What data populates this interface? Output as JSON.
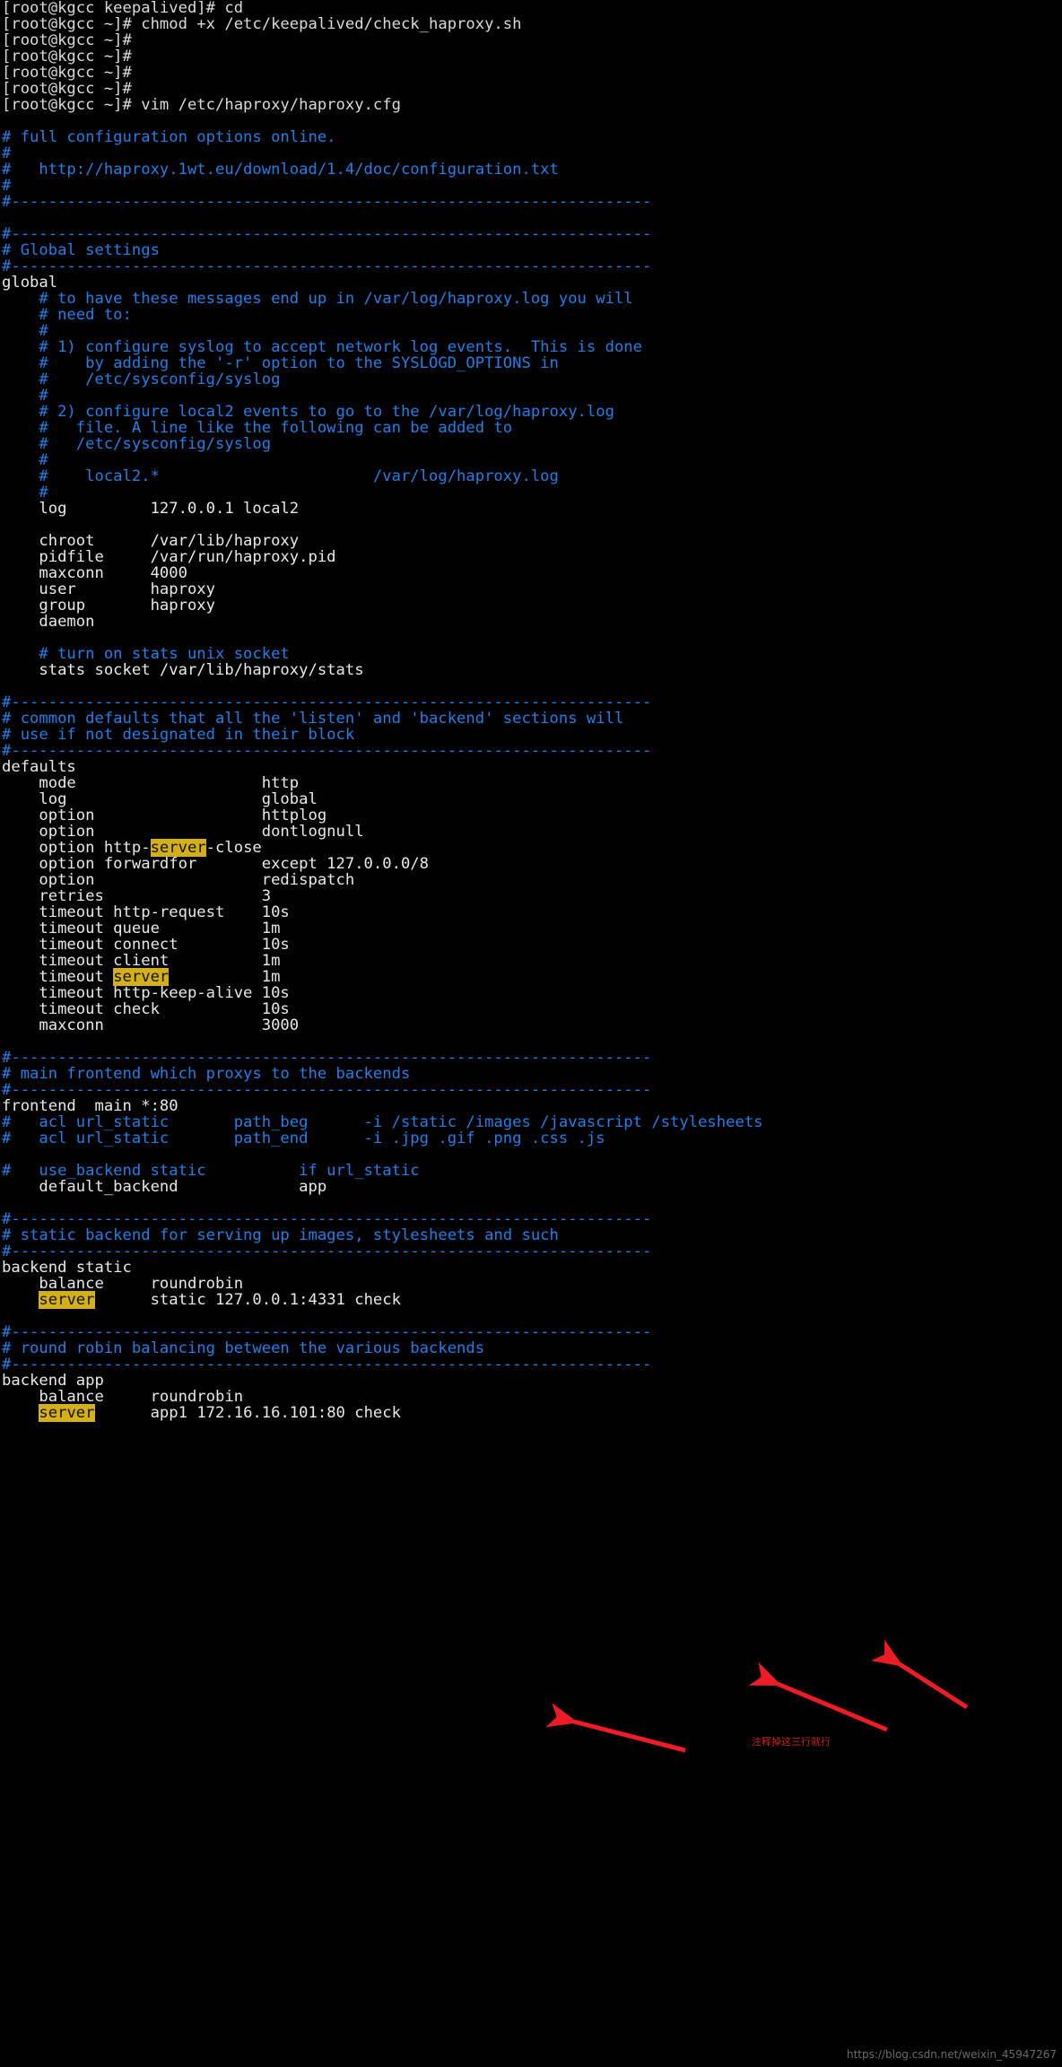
{
  "window": {
    "app": "vim",
    "shell_prompt": "[root@kgcc ~]#",
    "file": "/etc/haproxy/haproxy.cfg"
  },
  "colors": {
    "background": "#000000",
    "comment": "#1f7fe8",
    "normal_text": "#e8e8e8",
    "shell_text": "#d9d9d9",
    "search_highlight_bg": "#d4b017",
    "search_highlight_fg": "#121212",
    "annotation_red": "#ee1c25",
    "watermark": "#6a6a6a"
  },
  "search_term": "server",
  "shell": {
    "lines": [
      "[root@kgcc keepalived]# cd",
      "[root@kgcc ~]# chmod +x /etc/keepalived/check_haproxy.sh",
      "[root@kgcc ~]#",
      "[root@kgcc ~]#",
      "[root@kgcc ~]#",
      "[root@kgcc ~]#",
      "[root@kgcc ~]# vim /etc/haproxy/haproxy.cfg"
    ]
  },
  "editor": {
    "lines": [
      {
        "type": "blank",
        "text": ""
      },
      {
        "type": "comment",
        "text": "# full configuration options online."
      },
      {
        "type": "comment",
        "text": "#"
      },
      {
        "type": "comment",
        "text": "#   http://haproxy.1wt.eu/download/1.4/doc/configuration.txt"
      },
      {
        "type": "comment",
        "text": "#"
      },
      {
        "type": "comment",
        "text": "#---------------------------------------------------------------------"
      },
      {
        "type": "blank",
        "text": ""
      },
      {
        "type": "comment",
        "text": "#---------------------------------------------------------------------"
      },
      {
        "type": "comment",
        "text": "# Global settings"
      },
      {
        "type": "comment",
        "text": "#---------------------------------------------------------------------"
      },
      {
        "type": "text",
        "text": "global"
      },
      {
        "type": "comment",
        "text": "    # to have these messages end up in /var/log/haproxy.log you will"
      },
      {
        "type": "comment",
        "text": "    # need to:"
      },
      {
        "type": "comment",
        "text": "    #"
      },
      {
        "type": "comment",
        "text": "    # 1) configure syslog to accept network log events.  This is done"
      },
      {
        "type": "comment",
        "text": "    #    by adding the '-r' option to the SYSLOGD_OPTIONS in"
      },
      {
        "type": "comment",
        "text": "    #    /etc/sysconfig/syslog"
      },
      {
        "type": "comment",
        "text": "    #"
      },
      {
        "type": "comment",
        "text": "    # 2) configure local2 events to go to the /var/log/haproxy.log"
      },
      {
        "type": "comment",
        "text": "    #   file. A line like the following can be added to"
      },
      {
        "type": "comment",
        "text": "    #   /etc/sysconfig/syslog"
      },
      {
        "type": "comment",
        "text": "    #"
      },
      {
        "type": "comment",
        "text": "    #    local2.*                       /var/log/haproxy.log"
      },
      {
        "type": "comment",
        "text": "    #"
      },
      {
        "type": "text",
        "text": "    log         127.0.0.1 local2"
      },
      {
        "type": "blank",
        "text": ""
      },
      {
        "type": "text",
        "text": "    chroot      /var/lib/haproxy"
      },
      {
        "type": "text",
        "text": "    pidfile     /var/run/haproxy.pid"
      },
      {
        "type": "text",
        "text": "    maxconn     4000"
      },
      {
        "type": "text",
        "text": "    user        haproxy"
      },
      {
        "type": "text",
        "text": "    group       haproxy"
      },
      {
        "type": "text",
        "text": "    daemon"
      },
      {
        "type": "blank",
        "text": ""
      },
      {
        "type": "comment",
        "text": "    # turn on stats unix socket"
      },
      {
        "type": "text",
        "text": "    stats socket /var/lib/haproxy/stats"
      },
      {
        "type": "blank",
        "text": ""
      },
      {
        "type": "comment",
        "text": "#---------------------------------------------------------------------"
      },
      {
        "type": "comment",
        "text": "# common defaults that all the 'listen' and 'backend' sections will"
      },
      {
        "type": "comment",
        "text": "# use if not designated in their block"
      },
      {
        "type": "comment",
        "text": "#---------------------------------------------------------------------"
      },
      {
        "type": "text",
        "text": "defaults"
      },
      {
        "type": "text",
        "text": "    mode                    http"
      },
      {
        "type": "text",
        "text": "    log                     global"
      },
      {
        "type": "text",
        "text": "    option                  httplog"
      },
      {
        "type": "text",
        "text": "    option                  dontlognull"
      },
      {
        "type": "text_hl",
        "pre": "    option http-",
        "hl": "server",
        "post": "-close"
      },
      {
        "type": "text",
        "text": "    option forwardfor       except 127.0.0.0/8"
      },
      {
        "type": "text",
        "text": "    option                  redispatch"
      },
      {
        "type": "text",
        "text": "    retries                 3"
      },
      {
        "type": "text",
        "text": "    timeout http-request    10s"
      },
      {
        "type": "text",
        "text": "    timeout queue           1m"
      },
      {
        "type": "text",
        "text": "    timeout connect         10s"
      },
      {
        "type": "text",
        "text": "    timeout client          1m"
      },
      {
        "type": "text_hl",
        "pre": "    timeout ",
        "hl": "server",
        "post": "          1m"
      },
      {
        "type": "text",
        "text": "    timeout http-keep-alive 10s"
      },
      {
        "type": "text",
        "text": "    timeout check           10s"
      },
      {
        "type": "text",
        "text": "    maxconn                 3000"
      },
      {
        "type": "blank",
        "text": ""
      },
      {
        "type": "comment",
        "text": "#---------------------------------------------------------------------"
      },
      {
        "type": "comment",
        "text": "# main frontend which proxys to the backends"
      },
      {
        "type": "comment",
        "text": "#---------------------------------------------------------------------"
      },
      {
        "type": "text",
        "text": "frontend  main *:80"
      },
      {
        "type": "comment",
        "text": "#   acl url_static       path_beg      -i /static /images /javascript /stylesheets"
      },
      {
        "type": "comment",
        "text": "#   acl url_static       path_end      -i .jpg .gif .png .css .js"
      },
      {
        "type": "blank",
        "text": ""
      },
      {
        "type": "comment",
        "text": "#   use_backend static          if url_static"
      },
      {
        "type": "text",
        "text": "    default_backend             app"
      },
      {
        "type": "blank",
        "text": ""
      },
      {
        "type": "comment",
        "text": "#---------------------------------------------------------------------"
      },
      {
        "type": "comment",
        "text": "# static backend for serving up images, stylesheets and such"
      },
      {
        "type": "comment",
        "text": "#---------------------------------------------------------------------"
      },
      {
        "type": "text",
        "text": "backend static"
      },
      {
        "type": "text",
        "text": "    balance     roundrobin"
      },
      {
        "type": "text_hl",
        "pre": "    ",
        "hl": "server",
        "post": "      static 127.0.0.1:4331 check"
      },
      {
        "type": "blank",
        "text": ""
      },
      {
        "type": "comment",
        "text": "#---------------------------------------------------------------------"
      },
      {
        "type": "comment",
        "text": "# round robin balancing between the various backends"
      },
      {
        "type": "comment",
        "text": "#---------------------------------------------------------------------"
      },
      {
        "type": "text",
        "text": "backend app"
      },
      {
        "type": "text",
        "text": "    balance     roundrobin"
      },
      {
        "type": "text_hl",
        "pre": "    ",
        "hl": "server",
        "post": "      app1 172.16.16.101:80 check"
      }
    ]
  },
  "annotations": {
    "chinese_note": "注释掉这三行就行",
    "arrow_count": 3
  },
  "watermark": "https://blog.csdn.net/weixin_45947267"
}
